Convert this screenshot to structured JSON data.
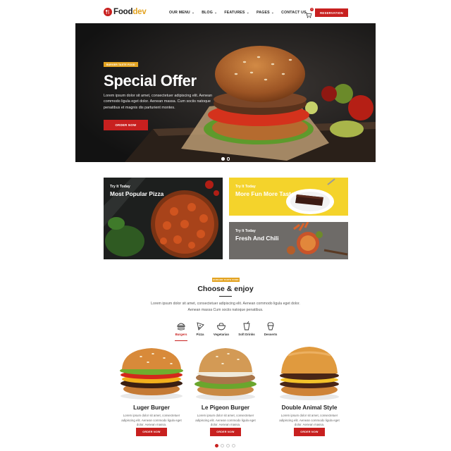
{
  "brand": {
    "name_main": "Food",
    "name_accent": "dev",
    "accent_color": "#e3a321",
    "brand_color": "#c8201f"
  },
  "nav": {
    "items": [
      "OUR MENU",
      "BLOG",
      "FEATURES",
      "PAGES",
      "CONTACT US"
    ]
  },
  "header": {
    "cart_icon": "cart-icon",
    "cart_count": "0",
    "reserve_label": "RESERVATION"
  },
  "hero": {
    "tag": "BURGER TASTE FOOD",
    "title": "Special Offer",
    "text": "Lorem ipsum dolor sit amet, consectetuer adipiscing elit. Aenean commodo ligula eget dolor. Aenean massa. Cum sociis natoque penatibus et magnis dis parturient montes.",
    "button": "ORDER NOW",
    "slides": 2,
    "active_slide": 1
  },
  "promos": [
    {
      "kicker": "Try It Today",
      "title": "Most Popular Pizza"
    },
    {
      "kicker": "Try It Today",
      "title": "More Fun More Taste"
    },
    {
      "kicker": "Try It Today",
      "title": "Fresh And Chili"
    }
  ],
  "section": {
    "tag": "BURGER TASTE FOOD",
    "title": "Choose & enjoy",
    "description": "Lorem ipsum dolor sit amet, consectetuer adipiscing elit. Aenean commodo ligula eget dolor. Aenean massa Cum sociis natoque penatibus."
  },
  "categories": [
    {
      "label": "Burgers",
      "icon": "burger-icon",
      "active": true
    },
    {
      "label": "Pizza",
      "icon": "pizza-icon",
      "active": false
    },
    {
      "label": "Vegetarian",
      "icon": "salad-bowl-icon",
      "active": false
    },
    {
      "label": "Soft Drinks",
      "icon": "drink-icon",
      "active": false
    },
    {
      "label": "Desserts",
      "icon": "cupcake-icon",
      "active": false
    }
  ],
  "products": [
    {
      "name": "Luger Burger",
      "description": "Lorem ipsum dolor sit amet, consectetuer adipiscing elit. Aenean commodo ligula eget dolor. Aenean massa.",
      "button": "ORDER NOW"
    },
    {
      "name": "Le Pigeon Burger",
      "description": "Lorem ipsum dolor sit amet, consectetuer adipiscing elit. Aenean commodo ligula eget dolor. Aenean massa.",
      "button": "ORDER NOW"
    },
    {
      "name": "Double Animal Style",
      "description": "Lorem ipsum dolor sit amet, consectetuer adipiscing elit. Aenean commodo ligula eget dolor. Aenean massa.",
      "button": "ORDER NOW"
    }
  ],
  "product_pager": {
    "pages": 4,
    "active": 1
  }
}
